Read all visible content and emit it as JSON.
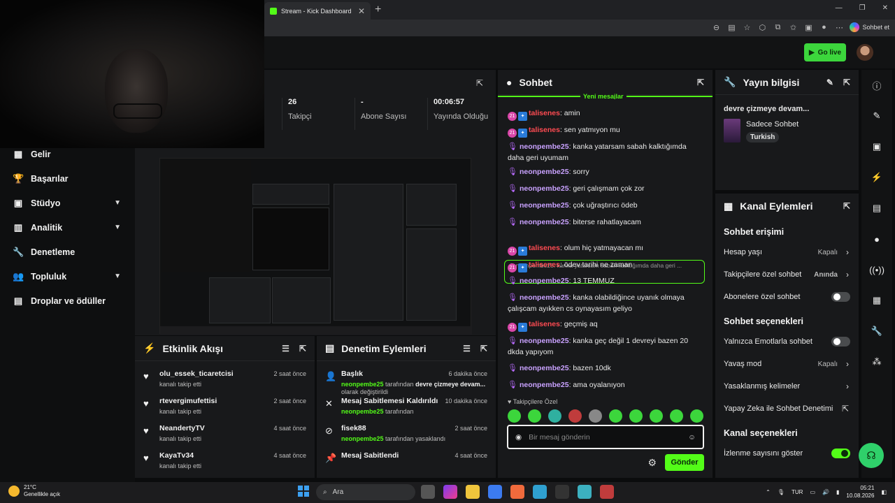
{
  "browser": {
    "tab_title": "Stream - Kick Dashboard",
    "new_tab": "+",
    "copilot_label": "Sohbet et"
  },
  "header": {
    "go_live": "Go live"
  },
  "sidebar": {
    "items": [
      {
        "label": "Gelir",
        "icon": "money-icon",
        "chevron": false
      },
      {
        "label": "Başarılar",
        "icon": "trophy-icon",
        "chevron": false
      },
      {
        "label": "Stüdyo",
        "icon": "studio-icon",
        "chevron": true
      },
      {
        "label": "Analitik",
        "icon": "analytics-icon",
        "chevron": true
      },
      {
        "label": "Denetleme",
        "icon": "wrench-icon",
        "chevron": false
      },
      {
        "label": "Topluluk",
        "icon": "community-icon",
        "chevron": true
      },
      {
        "label": "Droplar ve ödüller",
        "icon": "drops-icon",
        "chevron": false
      }
    ]
  },
  "stats": [
    {
      "value": "26",
      "label": "Takipçi"
    },
    {
      "value": "-",
      "label": "Abone Sayısı"
    },
    {
      "value": "00:06:57",
      "label": "Yayında Olduğu"
    }
  ],
  "activity": {
    "title": "Etkinlik Akışı",
    "items": [
      {
        "name": "olu_essek_ticaretcisi",
        "sub": "kanalı takip etti",
        "time": "2 saat önce"
      },
      {
        "name": "rtevergimufettisi",
        "sub": "kanalı takip etti",
        "time": "2 saat önce"
      },
      {
        "name": "NeandertyTV",
        "sub": "kanalı takip etti",
        "time": "4 saat önce"
      },
      {
        "name": "KayaTv34",
        "sub": "kanalı takip etti",
        "time": "4 saat önce"
      }
    ]
  },
  "modlog": {
    "title": "Denetim Eylemleri",
    "items": [
      {
        "name": "Başlık",
        "actor": "neonpembe25",
        "sub1": " tarafından ",
        "bold": "devre çizmeye devam...",
        "sub2": " olarak değiştirildi",
        "time": "6 dakika önce"
      },
      {
        "name": "Mesaj Sabitlemesi Kaldırıldı",
        "actor": "neonpembe25",
        "sub1": " tarafından",
        "bold": "",
        "sub2": "",
        "time": "10 dakika önce"
      },
      {
        "name": "fisek88",
        "actor": "neonpembe25",
        "sub1": " tarafından yasaklandı",
        "bold": "",
        "sub2": "",
        "time": "2 saat önce"
      },
      {
        "name": "Mesaj Sabitlendi",
        "actor": "",
        "sub1": "",
        "bold": "",
        "sub2": "",
        "time": "4 saat önce"
      }
    ]
  },
  "chat": {
    "title": "Sohbet",
    "new_messages": "Yeni mesajlar",
    "reply_preview": "neonpembe25: kanka yatarsam sabah kalktığımda daha geri ...",
    "messages": [
      {
        "user": "talisenes",
        "text": "amin",
        "kind": "red"
      },
      {
        "user": "talisenes",
        "text": "sen yatmıyon mu",
        "kind": "red"
      },
      {
        "user": "neonpembe25",
        "text": "kanka yatarsam sabah kalktığımda daha geri uyumam",
        "kind": "pur"
      },
      {
        "user": "neonpembe25",
        "text": "sorry",
        "kind": "pur"
      },
      {
        "user": "neonpembe25",
        "text": "geri çalışmam çok zor",
        "kind": "pur"
      },
      {
        "user": "neonpembe25",
        "text": "çok uğraştırıcı ödeb",
        "kind": "pur"
      },
      {
        "user": "neonpembe25",
        "text": "biterse rahatlayacam",
        "kind": "pur"
      },
      {
        "user": "talisenes",
        "text": "olum hiç yatmayacan mı",
        "kind": "red"
      },
      {
        "user": "talisenes",
        "text": "ödev tarihi ne zaman",
        "kind": "red"
      },
      {
        "user": "neonpembe25",
        "text": "13 TEMMUZ",
        "kind": "pur"
      },
      {
        "user": "neonpembe25",
        "text": "kanka olabildiğince uyanık olmaya çalışcam ayıkken cs oynayasım geliyo",
        "kind": "pur"
      },
      {
        "user": "talisenes",
        "text": "geçmiş aq",
        "kind": "red"
      },
      {
        "user": "neonpembe25",
        "text": "kanka geç değil 1 devreyi bazen 20 dkda yapıyom",
        "kind": "pur"
      },
      {
        "user": "neonpembe25",
        "text": "bazen 10dk",
        "kind": "pur"
      },
      {
        "user": "neonpembe25",
        "text": "ama oyalanıyon",
        "kind": "pur"
      }
    ],
    "followers_only": "Takipçilere Özel",
    "input_placeholder": "Bir mesaj gönderin",
    "send_label": "Gönder"
  },
  "stream_info": {
    "title": "Yayın bilgisi",
    "stream_title": "devre çizmeye devam...",
    "category": "Sadece Sohbet",
    "language": "Turkish"
  },
  "channel_actions": {
    "title": "Kanal Eylemleri",
    "chat_access": "Sohbet erişimi",
    "account_age": "Hesap yaşı",
    "account_age_value": "Kapalı",
    "followers_only": "Takipçilere özel sohbet",
    "followers_only_value": "Anında",
    "subs_only": "Abonelere özel sohbet",
    "chat_options": "Sohbet seçenekleri",
    "emotes_only": "Yalnızca Emotlarla sohbet",
    "slow_mode": "Yavaş mod",
    "slow_mode_value": "Kapalı",
    "banned_words": "Yasaklanmış kelimeler",
    "ai_moderation": "Yapay Zeka ile Sohbet Denetimi",
    "channel_options": "Kanal seçenekleri",
    "show_viewers": "İzlenme sayısını göster"
  },
  "taskbar": {
    "temp": "21°C",
    "weather": "Genellikle açık",
    "search": "Ara",
    "lang": "TUR",
    "time": "05:21",
    "date": "10.08.2026"
  },
  "colors": {
    "accent": "#53fc18",
    "red_user": "#ff4b52",
    "purple_user": "#c9a2ff"
  }
}
